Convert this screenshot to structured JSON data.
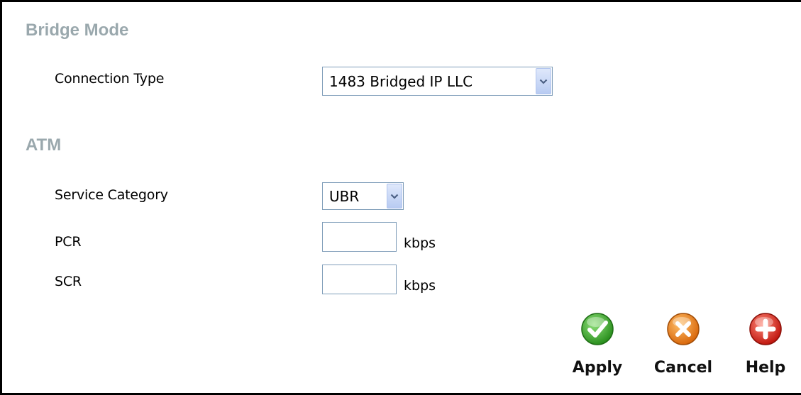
{
  "bridge_mode": {
    "title": "Bridge Mode",
    "connection_type": {
      "label": "Connection Type",
      "selected": "1483 Bridged IP LLC"
    }
  },
  "atm": {
    "title": "ATM",
    "service_category": {
      "label": "Service Category",
      "selected": "UBR"
    },
    "pcr": {
      "label": "PCR",
      "value": "",
      "unit": "kbps"
    },
    "scr": {
      "label": "SCR",
      "value": "",
      "unit": "kbps"
    }
  },
  "actions": {
    "apply": {
      "label": "Apply",
      "icon": "check-icon",
      "color": "#3aa12c"
    },
    "cancel": {
      "label": "Cancel",
      "icon": "x-icon",
      "color": "#e8801a"
    },
    "help": {
      "label": "Help",
      "icon": "plus-icon",
      "color": "#d42a22"
    }
  }
}
